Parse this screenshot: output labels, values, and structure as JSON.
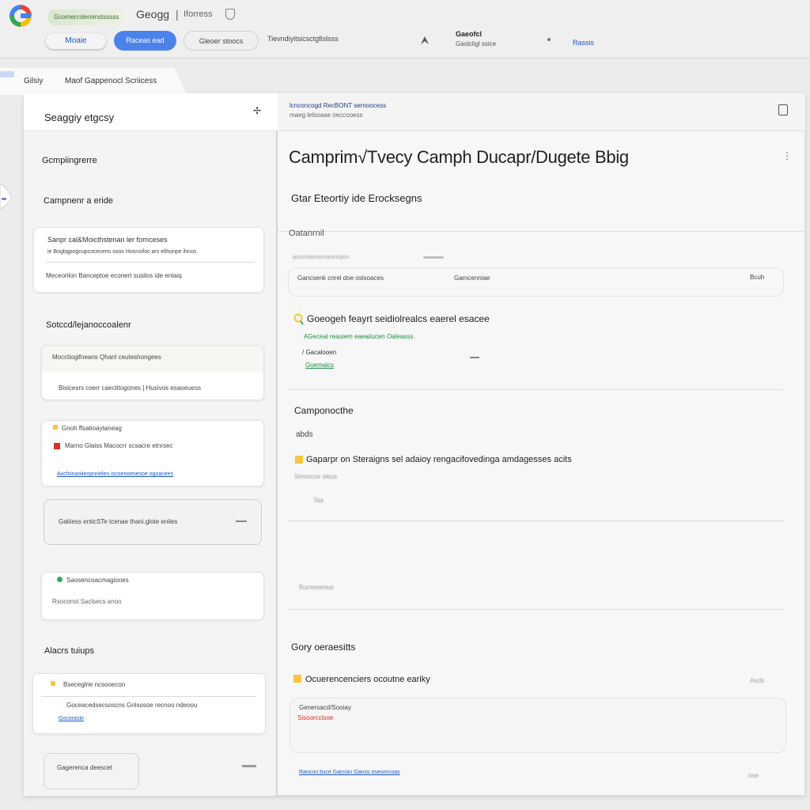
{
  "topbar": {
    "account_pill": "Gcomercoleminstsssss",
    "brand": "Geogg",
    "brand_separator": "|",
    "brand_sub": "Iforress",
    "tab_left": "Moaie",
    "primary_button": "Raceas ead",
    "outline_tab": "Gleoer stoocs",
    "menu_text": "Tievndiyitsicsctgfislsss",
    "account_name": "Gaeofcl",
    "account_sub": "Gaolcligl ssice",
    "top_link": "Rassis"
  },
  "breadcrumb": {
    "first": "Gilsiy",
    "second": "Maof Gappenocl Scriicess"
  },
  "sidebar": {
    "title": "Seaggiy etgcsy",
    "pin_glyph": "✢",
    "heading_1": "Gcmpiingrerre",
    "heading_2": "Campnenr a eride",
    "card1": {
      "line1": "Sanpr cal&Moicthstenan ler fornceses",
      "line2": "ie Bogbgpogcupcocecens sous Hosnsifoc ars elihonpe ihnos",
      "line3": "Meceorilon Banceptoe econert susilos ide enlaiq"
    },
    "heading_3": "Sotccd/lejanoccoalenr",
    "card2": {
      "line1": "Mocctiogifneans Qhanl ceuteshongees",
      "line2": "Bisicesrs coerr caectitogones | Husivos esaoeuess"
    },
    "card3": {
      "line1": "Gnoh ffsatioaytaneag",
      "line2": "Marno Glaiss Macocrr scsacre etnrsec",
      "line3": "Axcfsinaoiieopnnelen.Iscsenoesesoe ogoacees"
    },
    "card4": {
      "line1": "Gatiiess enticSTe tcenae thani.glote eniles"
    },
    "card5": {
      "line1": "Saosencoacmagiones",
      "line2": "Rsoconst Saclsecs anoo"
    },
    "heading_4": "Alacrs tuiups",
    "card6": {
      "line1": "Bseceglrie ncsooecon",
      "line2": "Goceacedsecsoscns Gnlsosoe recnoo ndeoou",
      "line3": "Gocorasio"
    },
    "footer_button": "Gagerenca deescet"
  },
  "content": {
    "breadcrumb": "lcnconcogd RecBONT sernoocess",
    "breadcrumb_sub": "maeg lelsoaae oeccooess",
    "page_title": "Camprim√Tvecy Camph Ducapr/Dugete Bbig",
    "sub_title": "Gtar Eteortiy ide Erocksegns",
    "overview_label": "Oatanrnil",
    "overview_hint": "assssxacoorcacescpcn",
    "row1_left": "Gancsenk cnrel doe oslsoaces",
    "row1_mid": "Gamcenniae",
    "row1_right": "Bcuh",
    "google_heading": "Goeogeh feayrt seidiolrealcs eaerel esacee",
    "google_green_1": "AGeceal reauiem eaeaiiucen Oaleasss",
    "google_green_2": "Gacalooen",
    "google_green_3": "Goemaics",
    "campaign_heading": "Camponocthe",
    "campaign_sub": "abds",
    "campaign_item": "Gaparpr on Steraigns sel adaioy rengacifovedinga amdagesses acits",
    "campaign_item_sub": "Sinnocoe sleus",
    "campaign_item_sub2": "Taa",
    "section3_hint": "Buceeseous",
    "settings_heading": "Gory oeraesitts",
    "settings_item": "Ocuerencenciers ocoutne eariky",
    "settings_item_right": "Ascb",
    "settings_card_line1": "Genersacd/Sooiay",
    "settings_card_line2": "Sisoorccisoe",
    "footer_link": "Rancon bsce Garcoin Ganss oseunrcoas",
    "footer_right": "ose"
  },
  "colors": {
    "accent_blue": "#4c83ea",
    "link_blue": "#1a56c9",
    "green": "#1e8e3e",
    "red": "#d93025",
    "yellow": "#f6c642"
  }
}
